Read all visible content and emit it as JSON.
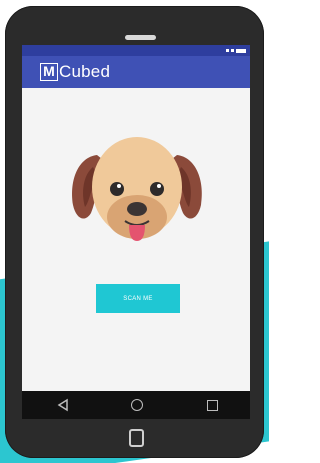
{
  "app": {
    "title": "Cubed",
    "logo_letter": "M"
  },
  "main": {
    "scan_button_label": "SCAN ME"
  },
  "navigation": {
    "back": "back-icon",
    "home": "home-icon",
    "recent": "recent-apps-icon"
  },
  "colors": {
    "app_bar": "#3f51b5",
    "status_bar": "#2e3e9e",
    "accent": "#1fc7d3",
    "background_accent": "#2cc6d0"
  }
}
